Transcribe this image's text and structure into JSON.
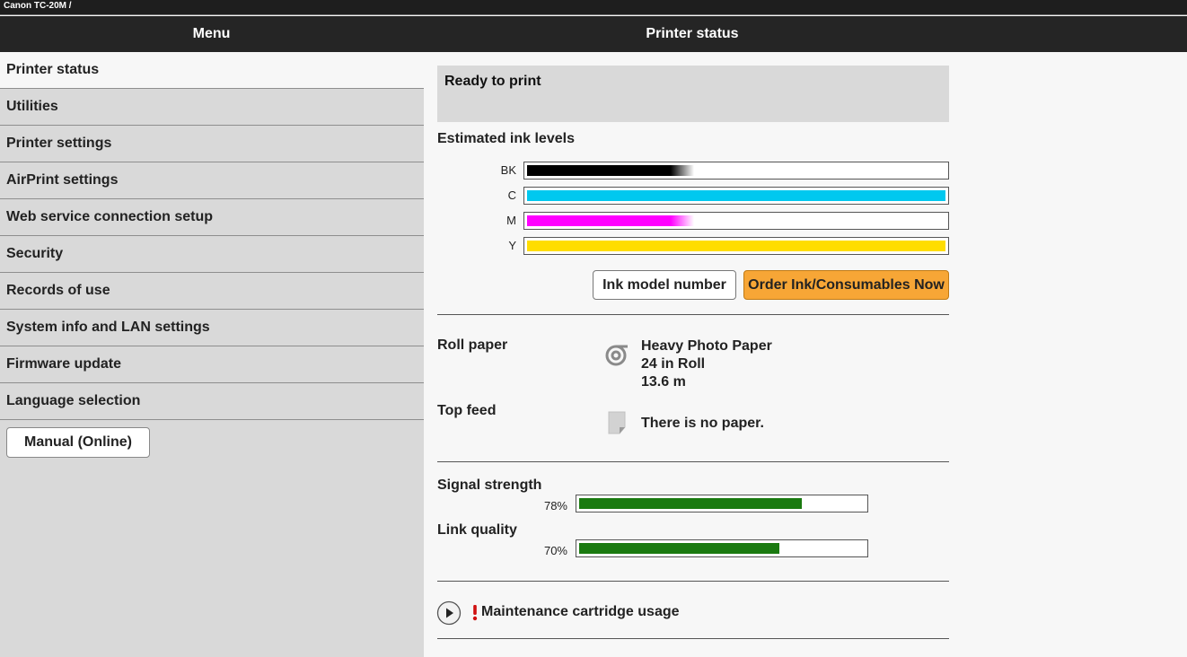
{
  "window": {
    "title": "Canon TC-20M /"
  },
  "header": {
    "menu_title": "Menu",
    "page_title": "Printer status"
  },
  "sidebar": {
    "items": [
      {
        "label": "Printer status",
        "active": true
      },
      {
        "label": "Utilities"
      },
      {
        "label": "Printer settings"
      },
      {
        "label": "AirPrint settings"
      },
      {
        "label": "Web service connection setup"
      },
      {
        "label": "Security"
      },
      {
        "label": "Records of use"
      },
      {
        "label": "System info and LAN settings"
      },
      {
        "label": "Firmware update"
      },
      {
        "label": "Language selection"
      }
    ],
    "manual_button": "Manual (Online)"
  },
  "status": {
    "message": "Ready to print"
  },
  "ink": {
    "heading": "Estimated ink levels",
    "levels": [
      {
        "name": "BK",
        "level": 0.4,
        "color": "#000000",
        "fade": true
      },
      {
        "name": "C",
        "level": 1.0,
        "color": "#00c8ef",
        "fade": false
      },
      {
        "name": "M",
        "level": 0.4,
        "color": "#ff00ff",
        "fade": true
      },
      {
        "name": "Y",
        "level": 1.0,
        "color": "#ffdd00",
        "fade": false
      }
    ],
    "model_button": "Ink model number",
    "order_button": "Order Ink/Consumables Now"
  },
  "paper": {
    "roll_label": "Roll paper",
    "roll_icon": "paper-roll-icon",
    "roll_lines": [
      "Heavy Photo Paper",
      "24 in Roll",
      "13.6 m"
    ],
    "top_label": "Top feed",
    "top_icon": "sheet-paper-icon",
    "top_text": "There is no paper."
  },
  "network": {
    "signal_label": "Signal strength",
    "signal_value": "78%",
    "signal_level": 0.78,
    "link_label": "Link quality",
    "link_value": "70%",
    "link_level": 0.7
  },
  "maintenance": {
    "icon": "play-icon",
    "warning_icon": "exclamation-icon",
    "label": "Maintenance cartridge usage"
  },
  "colors": {
    "accent": "#f7a636",
    "signal": "#1a7a10",
    "warning": "#d01010"
  }
}
